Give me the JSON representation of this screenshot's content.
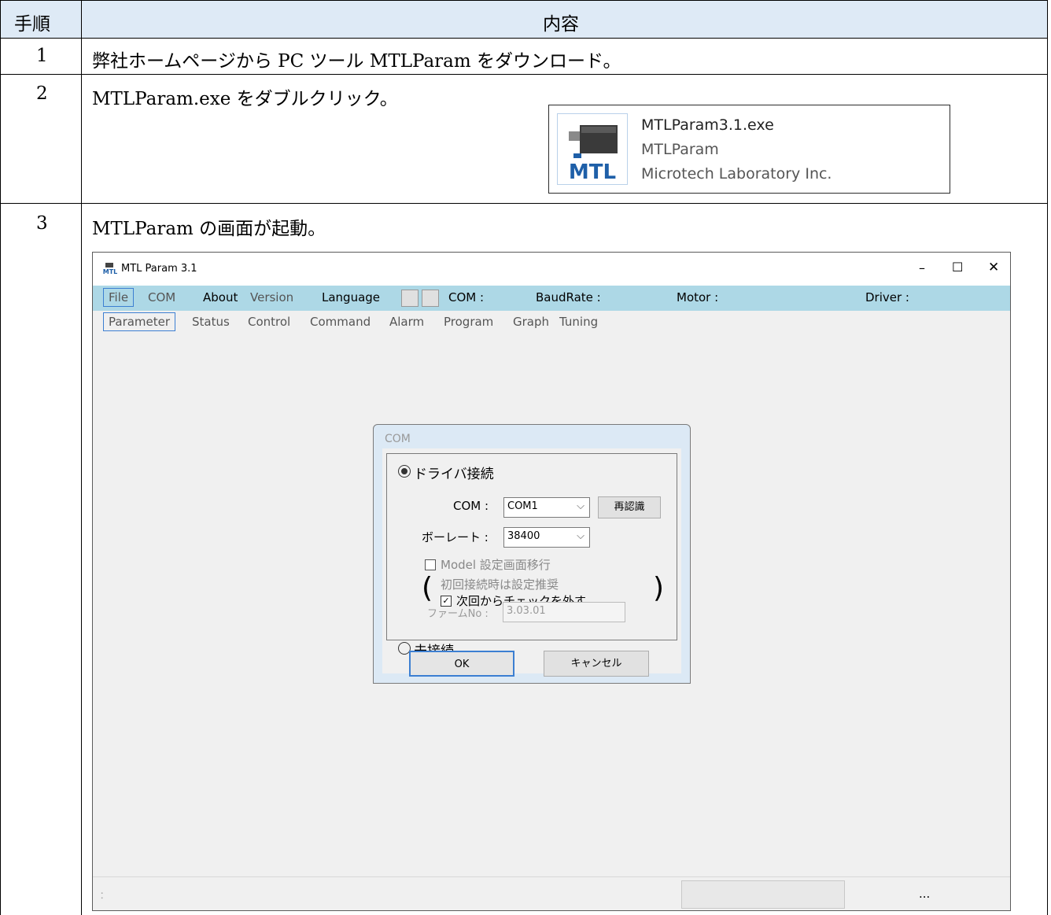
{
  "table": {
    "header": {
      "col1": "手順",
      "col2": "内容"
    },
    "rows": [
      {
        "num": "1",
        "text": "弊社ホームページから PC ツール MTLParam をダウンロード。"
      },
      {
        "num": "2",
        "text": "MTLParam.exe をダブルクリック。"
      },
      {
        "num": "3",
        "text": "MTLParam の画面が起動。"
      }
    ]
  },
  "file_tile": {
    "filename": "MTLParam3.1.exe",
    "description": "MTLParam",
    "company": "Microtech Laboratory Inc.",
    "logo_text": "MTL"
  },
  "app": {
    "title": "MTL Param 3.1",
    "logo_text": "MTL",
    "window_buttons": {
      "minimize": "–",
      "maximize": "☐",
      "close": "✕"
    },
    "menu": {
      "file": "File",
      "com": "COM",
      "about": "About",
      "version": "Version",
      "language": "Language",
      "com_status": "COM :",
      "baud_status": "BaudRate :",
      "motor_status": "Motor :",
      "driver_status": "Driver :"
    },
    "tabs": [
      "Parameter",
      "Status",
      "Control",
      "Command",
      "Alarm",
      "Program",
      "Graph",
      "Tuning"
    ],
    "status_ellipsis": "...",
    "grip": "⠨"
  },
  "dialog": {
    "title": "COM",
    "driver_connect": "ドライバ接続",
    "com_label": "COM :",
    "com_value": "COM1",
    "rescan_button": "再認識",
    "baud_label": "ボーレート :",
    "baud_value": "38400",
    "model_checkbox": "Model 設定画面移行",
    "note": "初回接続時は設定推奨",
    "next_checkbox": "次回からチェックを外す",
    "paren_left": "(",
    "paren_right": ")",
    "not_connected": "未接続",
    "firm_label": "ファームNo :",
    "firm_value": "3.03.01",
    "ok_button": "OK",
    "cancel_button": "キャンセル"
  }
}
